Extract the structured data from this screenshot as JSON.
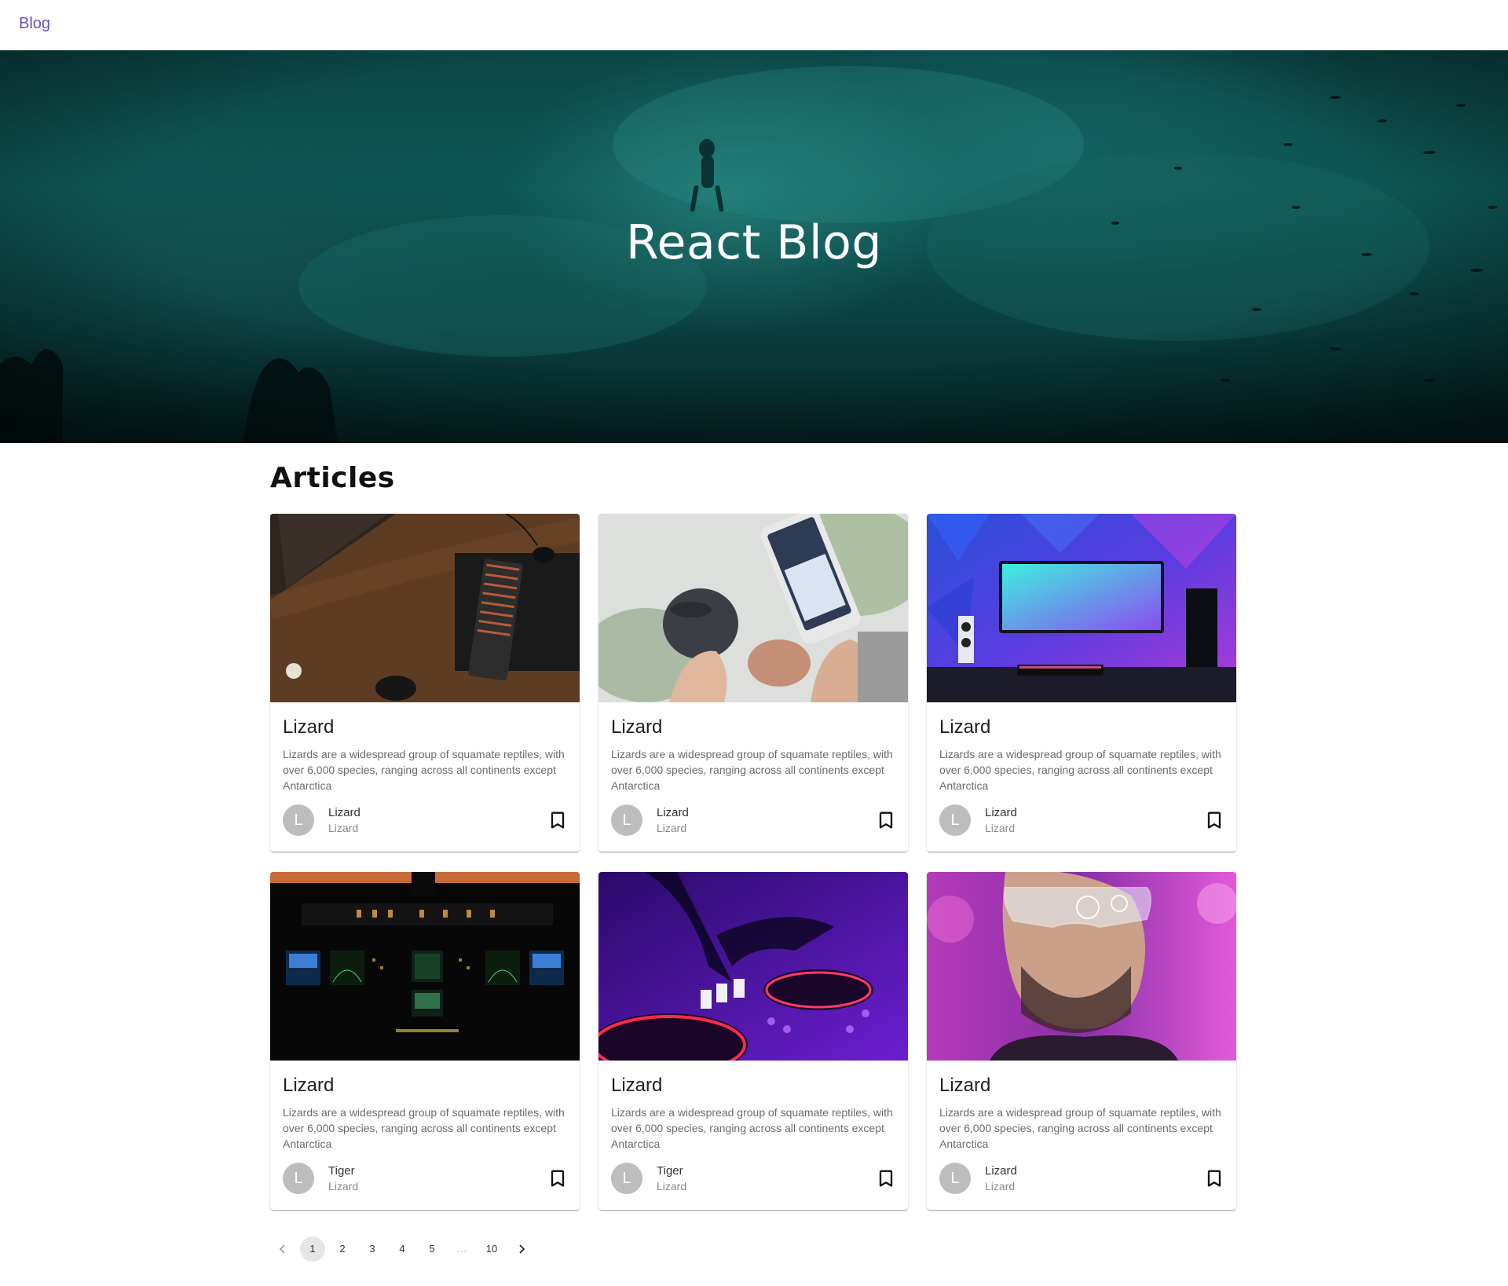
{
  "nav": {
    "brand": "Blog"
  },
  "hero": {
    "title": "React Blog"
  },
  "articles": {
    "heading": "Articles",
    "cards": [
      {
        "title": "Lizard",
        "text": "Lizards are a widespread group of squamate reptiles, with over 6,000 species, ranging across all continents except Antarctica",
        "avatar": "L",
        "author": "Lizard",
        "subtitle": "Lizard",
        "image": "desk-keyboard-photo"
      },
      {
        "title": "Lizard",
        "text": "Lizards are a widespread group of squamate reptiles, with over 6,000 species, ranging across all continents except Antarctica",
        "avatar": "L",
        "author": "Lizard",
        "subtitle": "Lizard",
        "image": "phone-earbuds-photo"
      },
      {
        "title": "Lizard",
        "text": "Lizards are a widespread group of squamate reptiles, with over 6,000 species, ranging across all continents except Antarctica",
        "avatar": "L",
        "author": "Lizard",
        "subtitle": "Lizard",
        "image": "neon-gaming-setup-photo"
      },
      {
        "title": "Lizard",
        "text": "Lizards are a widespread group of squamate reptiles, with over 6,000 species, ranging across all continents except Antarctica",
        "avatar": "L",
        "author": "Tiger",
        "subtitle": "Lizard",
        "image": "cockpit-photo"
      },
      {
        "title": "Lizard",
        "text": "Lizards are a widespread group of squamate reptiles, with over 6,000 species, ranging across all continents except Antarctica",
        "avatar": "L",
        "author": "Tiger",
        "subtitle": "Lizard",
        "image": "dj-mixer-photo"
      },
      {
        "title": "Lizard",
        "text": "Lizards are a widespread group of squamate reptiles, with over 6,000 species, ranging across all continents except Antarctica",
        "avatar": "L",
        "author": "Lizard",
        "subtitle": "Lizard",
        "image": "vr-glasses-man-photo"
      }
    ]
  },
  "pagination": {
    "prev_icon": "chevron-left-icon",
    "next_icon": "chevron-right-icon",
    "pages": [
      "1",
      "2",
      "3",
      "4",
      "5",
      "…",
      "10"
    ],
    "current": "1"
  },
  "colors": {
    "brand": "#6a4fc0",
    "hero_teal": "#0d5653",
    "avatar": "#bdbdbd"
  }
}
